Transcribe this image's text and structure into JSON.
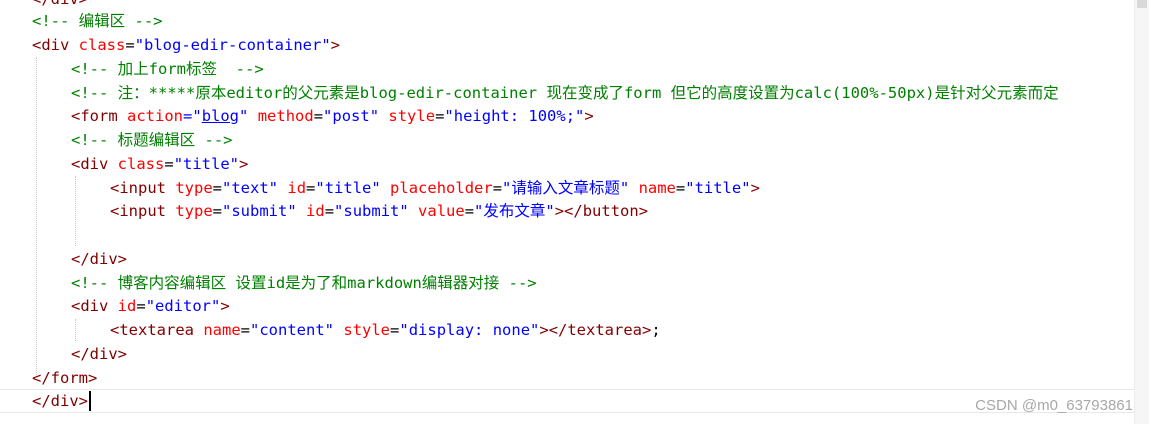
{
  "code": {
    "l0_close": "</div>",
    "l1_comment": "<!-- 编辑区 -->",
    "l2_open": "<div",
    "l2_attr": "class",
    "l2_val": "\"blog-edir-container\"",
    "l2_close": ">",
    "l3_comment": "<!-- 加上form标签  -->",
    "l4_comment": "<!-- 注：*****原本editor的父元素是blog-edir-container 现在变成了form 但它的高度设置为calc(100%-50px)是针对父元素而定",
    "l5_open": "<form",
    "l5_attr1": "action",
    "l5_val1_q1": "=\"",
    "l5_val1_link": "blog",
    "l5_val1_q2": "\"",
    "l5_attr2": "method",
    "l5_val2": "\"post\"",
    "l5_attr3": "style",
    "l5_val3": "\"height: 100%;\"",
    "l5_close": ">",
    "l6_comment": "<!-- 标题编辑区 -->",
    "l7_open": "<div",
    "l7_attr": "class",
    "l7_val": "\"title\"",
    "l7_close": ">",
    "l8_open": "<input",
    "l8_attr1": "type",
    "l8_val1": "\"text\"",
    "l8_attr2": "id",
    "l8_val2": "\"title\"",
    "l8_attr3": "placeholder",
    "l8_val3": "\"请输入文章标题\"",
    "l8_attr4": "name",
    "l8_val4": "\"title\"",
    "l8_close": ">",
    "l9_open": "<input",
    "l9_attr1": "type",
    "l9_val1": "\"submit\"",
    "l9_attr2": "id",
    "l9_val2": "\"submit\"",
    "l9_attr3": "value",
    "l9_val3": "\"发布文章\"",
    "l9_close": "></button>",
    "l11_close": "</div>",
    "l12_comment": "<!-- 博客内容编辑区 设置id是为了和markdown编辑器对接 -->",
    "l13_open": "<div",
    "l13_attr": "id",
    "l13_val": "\"editor\"",
    "l13_close": ">",
    "l14_open": "<textarea",
    "l14_attr1": "name",
    "l14_val1": "\"content\"",
    "l14_attr2": "style",
    "l14_val2": "\"display: none\"",
    "l14_close": "></textarea>",
    "l14_semi": ";",
    "l15_close": "</div>",
    "l16_close": "</form>",
    "l17_close": "</div>"
  },
  "watermark": "CSDN @m0_63793861"
}
